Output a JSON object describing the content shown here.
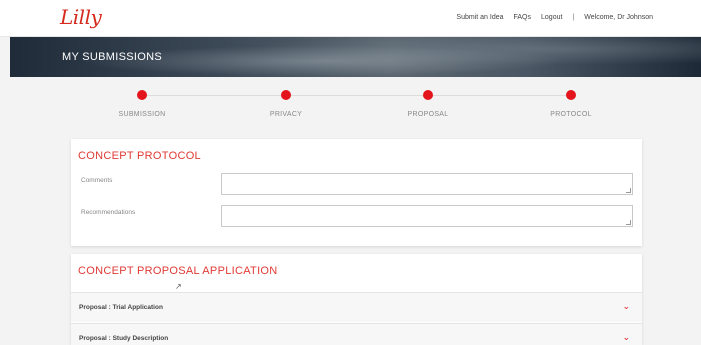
{
  "header": {
    "logo": "Lilly",
    "nav": [
      "Submit an Idea",
      "FAQs",
      "Logout"
    ],
    "separator": "|",
    "welcome": "Welcome, Dr Johnson"
  },
  "banner": {
    "title": "MY SUBMISSIONS"
  },
  "steps": [
    {
      "label": "SUBMISSION"
    },
    {
      "label": "PRIVACY"
    },
    {
      "label": "PROPOSAL"
    },
    {
      "label": "PROTOCOL"
    }
  ],
  "protocol": {
    "title": "CONCEPT PROTOCOL",
    "fields": [
      {
        "label": "Comments",
        "value": ""
      },
      {
        "label": "Recommendations",
        "value": ""
      }
    ]
  },
  "proposal": {
    "title": "CONCEPT PROPOSAL APPLICATION",
    "sections": [
      {
        "label": "Proposal : Trial Application"
      },
      {
        "label": "Proposal : Study Description"
      }
    ]
  },
  "colors": {
    "accent": "#e3141b",
    "title": "#e03a34"
  },
  "icons": {
    "chevron": "chevron-down-icon",
    "cursor": "mouse-cursor-icon"
  }
}
